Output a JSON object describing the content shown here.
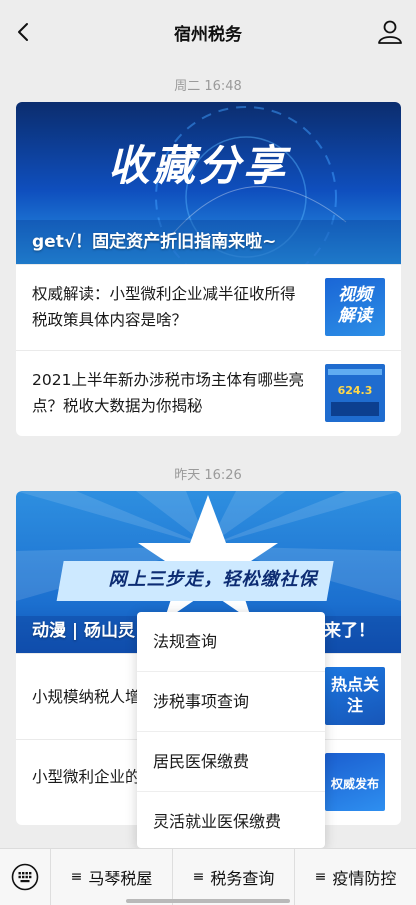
{
  "header": {
    "title": "宿州税务"
  },
  "messages": [
    {
      "time": "周二 16:48",
      "cover": {
        "art_text": "收藏分享",
        "caption": "get√！固定资产折旧指南来啦~"
      },
      "items": [
        {
          "title": "权威解读：小型微利企业减半征收所得税政策具体内容是啥？",
          "thumb_text": "视频解读"
        },
        {
          "title": "2021上半年新办涉税市场主体有哪些亮点？税收大数据为你揭秘",
          "thumb_text": "624.3"
        }
      ]
    },
    {
      "time": "昨天 16:26",
      "cover": {
        "art_text": "网上三步走，轻松缴社保",
        "caption": "动漫 | 砀山灵",
        "caption_right": "捏来了！"
      },
      "items": [
        {
          "title": "小规模纳税人增",
          "thumb_text": "热点关注"
        },
        {
          "title": "小型微利企业的",
          "thumb_text": "权威发布"
        }
      ]
    }
  ],
  "popup_menu": [
    "法规查询",
    "涉税事项查询",
    "居民医保缴费",
    "灵活就业医保缴费"
  ],
  "bottom_menu": [
    "马琴税屋",
    "税务查询",
    "疫情防控"
  ],
  "colors": {
    "background": "#ededed",
    "accent_blue": "#1b6fcf"
  }
}
